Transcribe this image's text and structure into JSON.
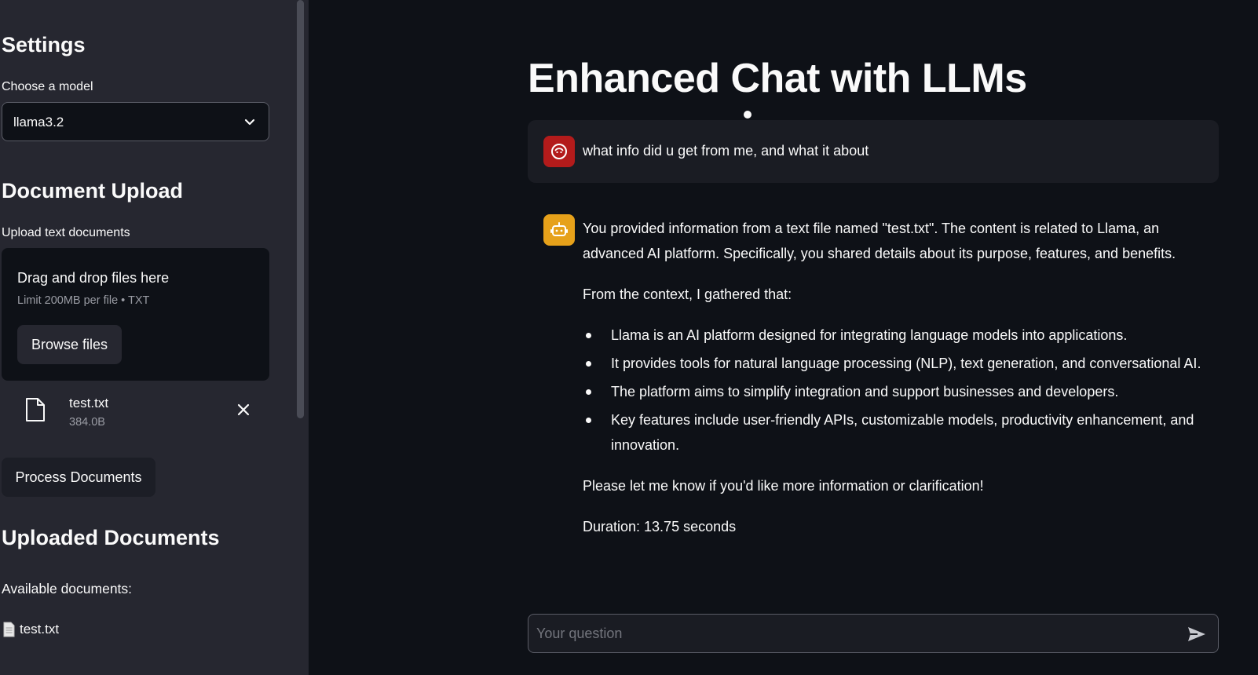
{
  "sidebar": {
    "settings_heading": "Settings",
    "model_label": "Choose a model",
    "model_value": "llama3.2",
    "upload_heading": "Document Upload",
    "upload_label": "Upload text documents",
    "dropzone": {
      "title": "Drag and drop files here",
      "limit": "Limit 200MB per file • TXT",
      "browse_label": "Browse files"
    },
    "uploaded_file": {
      "name": "test.txt",
      "size": "384.0B"
    },
    "process_label": "Process Documents",
    "uploaded_heading": "Uploaded Documents",
    "available_label": "Available documents:",
    "documents": [
      "test.txt"
    ]
  },
  "main": {
    "title": "Enhanced Chat with LLMs",
    "user_message": "what info did u get from me, and what it about",
    "assistant": {
      "intro": "You provided information from a text file named \"test.txt\". The content is related to Llama, an advanced AI platform. Specifically, you shared details about its purpose, features, and benefits.",
      "context_line": "From the context, I gathered that:",
      "bullets": [
        "Llama is an AI platform designed for integrating language models into applications.",
        "It provides tools for natural language processing (NLP), text generation, and conversational AI.",
        "The platform aims to simplify integration and support businesses and developers.",
        "Key features include user-friendly APIs, customizable models, productivity enhancement, and innovation."
      ],
      "closing": "Please let me know if you'd like more information or clarification!",
      "duration": "Duration: 13.75 seconds"
    },
    "input_placeholder": "Your question"
  },
  "icons": {
    "model_dropdown": "chevron-down-icon",
    "uploaded_file": "file-icon",
    "remove_file": "close-icon",
    "document": "page-icon",
    "user_avatar": "face-icon",
    "assistant_avatar": "robot-icon",
    "send": "send-icon"
  },
  "colors": {
    "background": "#0e1117",
    "sidebar": "#262730",
    "user_avatar": "#b31b1b",
    "assistant_avatar": "#e6a11a"
  }
}
